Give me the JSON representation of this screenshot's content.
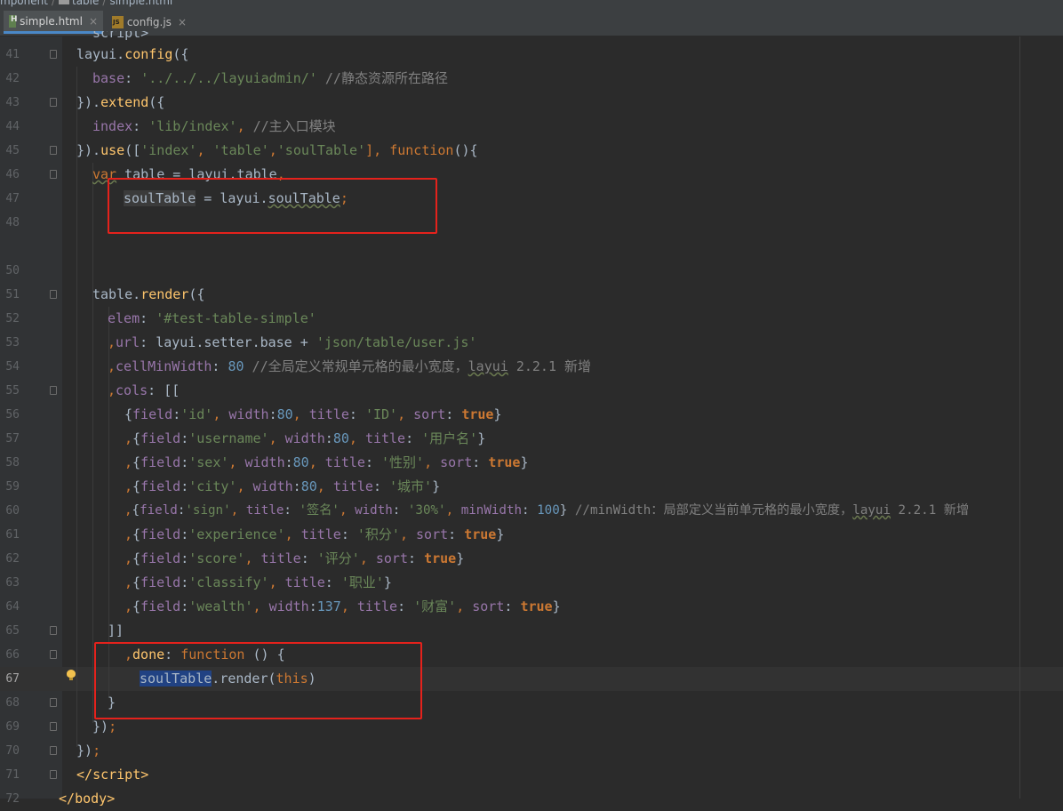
{
  "breadcrumb": [
    "mponent",
    "table",
    "simple.html"
  ],
  "tabs": [
    {
      "label": "simple.html",
      "close": "×",
      "icon": "html-file-icon",
      "active": true
    },
    {
      "label": "config.js",
      "close": "×",
      "icon": "js-file-icon",
      "active": false
    }
  ],
  "editor": {
    "caret_line": 67,
    "line_numbers": [
      "41",
      "42",
      "43",
      "44",
      "45",
      "46",
      "47",
      "48",
      "50",
      "51",
      "52",
      "53",
      "54",
      "55",
      "56",
      "57",
      "58",
      "59",
      "60",
      "61",
      "62",
      "63",
      "64",
      "65",
      "66",
      "67",
      "68",
      "69",
      "70",
      "71",
      "72"
    ],
    "partial_top_text": "script>",
    "text": {
      "l41": [
        "layui",
        ".",
        "config",
        "({"
      ],
      "l42": [
        "base",
        ": ",
        "'../../../layuiadmin/'",
        " //静态资源所在路径"
      ],
      "l43": [
        "}).",
        "extend",
        "({"
      ],
      "l44": [
        "index",
        ": ",
        "'lib/index'",
        ", ",
        "//主入口模块"
      ],
      "l45": [
        "}).",
        "use",
        "([",
        "'index'",
        ", ",
        "'table'",
        ",",
        "'soulTable'",
        "], ",
        "function",
        "(){"
      ],
      "l46": [
        "var",
        " table = ",
        "layui.table",
        ","
      ],
      "l47": [
        "soulTable",
        " = ",
        "layui",
        ".",
        "soulTable",
        ";"
      ],
      "l51": [
        "table",
        ".",
        "render",
        "({"
      ],
      "l52": [
        "elem",
        ": ",
        "'#test-table-simple'"
      ],
      "l53": [
        ",",
        "url",
        ": ",
        "layui",
        ".",
        "setter",
        ".",
        "base",
        " + ",
        "'json/table/user.js'"
      ],
      "l54": [
        ",",
        "cellMinWidth",
        ": ",
        "80",
        " //全局定义常规单元格的最小宽度，",
        "layui",
        " 2.2.1 新增"
      ],
      "l55": [
        ",",
        "cols",
        ": [["
      ],
      "l56": [
        "{",
        "field",
        ":",
        "'id'",
        ", ",
        "width",
        ":",
        "80",
        ", ",
        "title",
        ": ",
        "'ID'",
        ", ",
        "sort",
        ": ",
        "true",
        "}"
      ],
      "l57": [
        ",",
        "{",
        "field",
        ":",
        "'username'",
        ", ",
        "width",
        ":",
        "80",
        ", ",
        "title",
        ": ",
        "'用户名'",
        "}"
      ],
      "l58": [
        ",",
        "{",
        "field",
        ":",
        "'sex'",
        ", ",
        "width",
        ":",
        "80",
        ", ",
        "title",
        ": ",
        "'性别'",
        ", ",
        "sort",
        ": ",
        "true",
        "}"
      ],
      "l59": [
        ",",
        "{",
        "field",
        ":",
        "'city'",
        ", ",
        "width",
        ":",
        "80",
        ", ",
        "title",
        ": ",
        "'城市'",
        "}"
      ],
      "l60": [
        ",",
        "{",
        "field",
        ":",
        "'sign'",
        ", ",
        "title",
        ": ",
        "'签名'",
        ", ",
        "width",
        ": ",
        "'30%'",
        ", ",
        "minWidth",
        ": ",
        "100",
        "} ",
        "//minWidth：局部定义当前单元格的最小宽度，",
        "layui",
        " 2.2.1 新增"
      ],
      "l61": [
        ",",
        "{",
        "field",
        ":",
        "'experience'",
        ", ",
        "title",
        ": ",
        "'积分'",
        ", ",
        "sort",
        ": ",
        "true",
        "}"
      ],
      "l62": [
        ",",
        "{",
        "field",
        ":",
        "'score'",
        ", ",
        "title",
        ": ",
        "'评分'",
        ", ",
        "sort",
        ": ",
        "true",
        "}"
      ],
      "l63": [
        ",",
        "{",
        "field",
        ":",
        "'classify'",
        ", ",
        "title",
        ": ",
        "'职业'",
        "}"
      ],
      "l64": [
        ",",
        "{",
        "field",
        ":",
        "'wealth'",
        ", ",
        "width",
        ":",
        "137",
        ", ",
        "title",
        ": ",
        "'财富'",
        ", ",
        "sort",
        ": ",
        "true",
        "}"
      ],
      "l65": [
        "]]"
      ],
      "l66": [
        ",",
        "done",
        ": ",
        "function",
        " () {"
      ],
      "l67": [
        "soulTable",
        ".",
        "render",
        "(",
        "this",
        ")"
      ],
      "l68": [
        "}"
      ],
      "l69": [
        "})",
        ";"
      ],
      "l70": [
        "})",
        ";"
      ],
      "l71": [
        "</",
        "script",
        ">"
      ],
      "l72": [
        "</",
        "body",
        ">"
      ]
    }
  },
  "annotations": [
    "red-box-soultable-declaration",
    "red-box-done-callback"
  ],
  "colors": {
    "annotation": "#e5221c",
    "keyword": "#cc7832",
    "string": "#6a8759",
    "number": "#6897bb",
    "property": "#9876aa",
    "comment": "#808080",
    "function": "#ffc66d",
    "selection": "#214283"
  }
}
